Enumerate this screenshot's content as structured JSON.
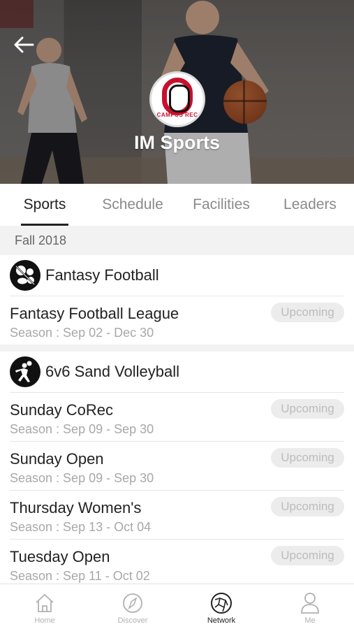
{
  "header": {
    "org_name": "IM Sports",
    "logo_text": "CAMPUS REC"
  },
  "tabs": [
    {
      "label": "Sports",
      "active": true
    },
    {
      "label": "Schedule",
      "active": false
    },
    {
      "label": "Facilities",
      "active": false
    },
    {
      "label": "Leaders",
      "active": false
    }
  ],
  "term": "Fall 2018",
  "groups": [
    {
      "title": "Fantasy Football",
      "icon": "multi-sport-icon",
      "leagues": [
        {
          "name": "Fantasy Football League",
          "season": "Season : Sep 02 - Dec 30",
          "status": "Upcoming"
        }
      ]
    },
    {
      "title": "6v6 Sand Volleyball",
      "icon": "volleyball-player-icon",
      "leagues": [
        {
          "name": "Sunday CoRec",
          "season": "Season : Sep 09 - Sep 30",
          "status": "Upcoming"
        },
        {
          "name": "Sunday Open",
          "season": "Season : Sep 09 - Sep 30",
          "status": "Upcoming"
        },
        {
          "name": "Thursday Women's",
          "season": "Season : Sep 13 - Oct 04",
          "status": "Upcoming"
        },
        {
          "name": "Tuesday Open",
          "season": "Season : Sep 11 - Oct 02",
          "status": "Upcoming"
        }
      ]
    }
  ],
  "bottom_nav": [
    {
      "label": "Home",
      "icon": "home-icon",
      "active": false
    },
    {
      "label": "Discover",
      "icon": "compass-icon",
      "active": false
    },
    {
      "label": "Network",
      "icon": "network-icon",
      "active": true
    },
    {
      "label": "Me",
      "icon": "person-icon",
      "active": false
    }
  ],
  "colors": {
    "accent": "#222222",
    "brand_red": "#c8102e",
    "muted": "#a8a8a8"
  }
}
